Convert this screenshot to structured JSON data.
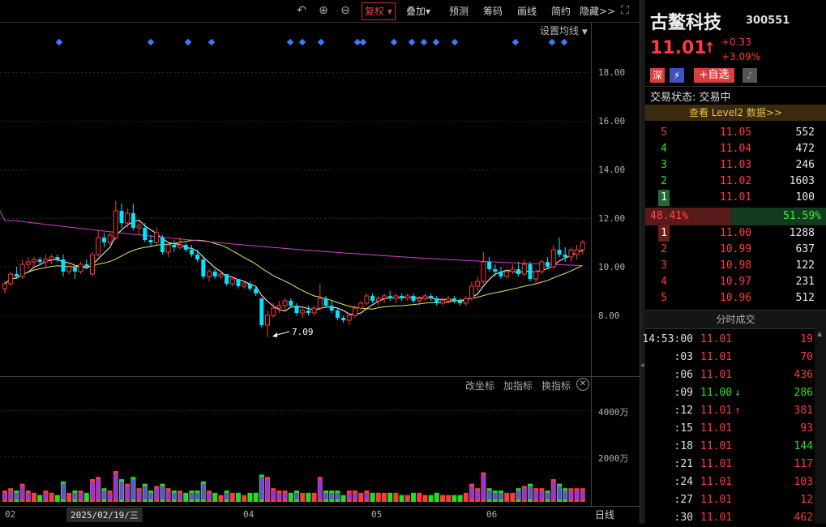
{
  "toolbar": {
    "fuquan": "复权",
    "diejia": "叠加",
    "yuce": "预测",
    "chouma": "筹码",
    "huaxian": "画线",
    "jianyue": "简约",
    "yincang": "隐藏>>",
    "undo_icon": "undo-icon",
    "zoom_in_icon": "zoom-in-icon",
    "zoom_out_icon": "zoom-out-icon",
    "expand_icon": "expand-icon"
  },
  "chart": {
    "set_ma_label": "设置均线",
    "price_ticks": [
      "18.00",
      "16.00",
      "14.00",
      "12.00",
      "10.00",
      "8.00"
    ],
    "low_annotation": "7.09",
    "indicator_buttons": [
      "改坐标",
      "加指标",
      "换指标"
    ],
    "volume_ticks": [
      "4000万",
      "2000万"
    ],
    "x_labels": [
      "02",
      "2025/02/19/三",
      "04",
      "05",
      "06"
    ],
    "period": "日线",
    "colors": {
      "up": "#ff3a3a",
      "down": "#00e5ff",
      "ma5": "#ffffff",
      "ma20": "#e8e85a",
      "ma60": "#d040d0",
      "signal": "#3a7cff"
    }
  },
  "chart_data": {
    "type": "candlestick",
    "ylim": [
      6.0,
      19.5
    ],
    "candles": [
      [
        9.1,
        9.4,
        8.9,
        9.3
      ],
      [
        9.3,
        9.8,
        9.2,
        9.7
      ],
      [
        9.7,
        10.0,
        9.5,
        9.6
      ],
      [
        9.6,
        10.3,
        9.5,
        10.1
      ],
      [
        10.1,
        10.4,
        9.9,
        10.2
      ],
      [
        10.2,
        10.4,
        10.0,
        10.3
      ],
      [
        10.3,
        10.4,
        10.1,
        10.2
      ],
      [
        10.2,
        10.5,
        10.0,
        10.3
      ],
      [
        10.3,
        10.5,
        10.1,
        10.4
      ],
      [
        10.4,
        10.5,
        10.2,
        10.3
      ],
      [
        10.3,
        10.5,
        9.6,
        9.8
      ],
      [
        9.8,
        10.1,
        9.7,
        10.0
      ],
      [
        10.0,
        10.0,
        9.5,
        9.8
      ],
      [
        9.8,
        10.2,
        9.7,
        10.1
      ],
      [
        10.1,
        10.3,
        9.9,
        10.0
      ],
      [
        9.7,
        10.6,
        9.6,
        10.5
      ],
      [
        10.5,
        11.5,
        10.4,
        11.2
      ],
      [
        11.2,
        11.4,
        10.8,
        11.0
      ],
      [
        11.0,
        11.4,
        10.9,
        11.3
      ],
      [
        11.2,
        12.7,
        11.1,
        12.3
      ],
      [
        12.3,
        12.6,
        11.6,
        11.8
      ],
      [
        11.8,
        12.4,
        11.6,
        12.2
      ],
      [
        12.2,
        12.6,
        11.5,
        11.6
      ],
      [
        11.6,
        11.9,
        11.3,
        11.7
      ],
      [
        11.6,
        11.8,
        11.0,
        11.1
      ],
      [
        11.1,
        11.3,
        10.8,
        11.0
      ],
      [
        11.0,
        11.6,
        10.9,
        11.4
      ],
      [
        11.2,
        11.3,
        10.5,
        10.6
      ],
      [
        10.6,
        11.0,
        10.4,
        10.9
      ],
      [
        10.9,
        11.1,
        10.6,
        10.8
      ],
      [
        10.8,
        11.2,
        10.7,
        10.9
      ],
      [
        10.9,
        11.0,
        10.6,
        10.7
      ],
      [
        10.7,
        10.9,
        10.4,
        10.5
      ],
      [
        10.5,
        10.7,
        10.2,
        10.3
      ],
      [
        10.3,
        10.4,
        9.5,
        9.6
      ],
      [
        9.6,
        9.9,
        9.4,
        9.8
      ],
      [
        9.8,
        9.9,
        9.5,
        9.6
      ],
      [
        9.6,
        9.8,
        9.5,
        9.7
      ],
      [
        9.7,
        9.7,
        9.2,
        9.3
      ],
      [
        9.3,
        9.6,
        9.2,
        9.5
      ],
      [
        9.5,
        9.5,
        9.1,
        9.2
      ],
      [
        9.2,
        9.4,
        9.1,
        9.3
      ],
      [
        9.3,
        9.4,
        9.0,
        9.1
      ],
      [
        9.1,
        9.2,
        8.8,
        8.9
      ],
      [
        8.7,
        8.7,
        7.5,
        7.6
      ],
      [
        7.6,
        8.2,
        7.1,
        8.0
      ],
      [
        8.0,
        8.5,
        7.9,
        8.3
      ],
      [
        8.3,
        8.6,
        8.1,
        8.4
      ],
      [
        8.4,
        8.7,
        8.2,
        8.6
      ],
      [
        8.6,
        8.7,
        8.3,
        8.4
      ],
      [
        8.4,
        8.5,
        8.0,
        8.1
      ],
      [
        8.1,
        8.3,
        7.9,
        8.2
      ],
      [
        8.2,
        8.4,
        8.0,
        8.1
      ],
      [
        8.1,
        8.4,
        8.0,
        8.3
      ],
      [
        8.3,
        9.3,
        8.2,
        8.7
      ],
      [
        8.7,
        8.8,
        8.3,
        8.4
      ],
      [
        8.4,
        8.6,
        8.1,
        8.2
      ],
      [
        8.2,
        8.3,
        7.8,
        7.9
      ],
      [
        7.9,
        8.0,
        7.7,
        7.8
      ],
      [
        7.8,
        8.1,
        7.6,
        8.0
      ],
      [
        8.0,
        8.4,
        7.9,
        8.3
      ],
      [
        8.3,
        8.6,
        8.2,
        8.5
      ],
      [
        8.5,
        8.9,
        8.4,
        8.8
      ],
      [
        8.8,
        8.9,
        8.5,
        8.6
      ],
      [
        8.6,
        8.8,
        8.4,
        8.7
      ],
      [
        8.7,
        8.9,
        8.5,
        8.8
      ],
      [
        8.8,
        9.0,
        8.6,
        8.7
      ],
      [
        8.7,
        8.9,
        8.5,
        8.8
      ],
      [
        8.8,
        8.9,
        8.6,
        8.7
      ],
      [
        8.7,
        8.9,
        8.6,
        8.8
      ],
      [
        8.8,
        8.9,
        8.5,
        8.6
      ],
      [
        8.6,
        8.8,
        8.4,
        8.7
      ],
      [
        8.7,
        8.9,
        8.6,
        8.8
      ],
      [
        8.8,
        8.9,
        8.6,
        8.7
      ],
      [
        8.7,
        8.8,
        8.4,
        8.5
      ],
      [
        8.5,
        8.7,
        8.4,
        8.6
      ],
      [
        8.6,
        8.8,
        8.5,
        8.7
      ],
      [
        8.7,
        8.8,
        8.5,
        8.6
      ],
      [
        8.6,
        8.7,
        8.4,
        8.5
      ],
      [
        8.5,
        8.8,
        8.4,
        8.7
      ],
      [
        8.7,
        9.4,
        8.6,
        9.2
      ],
      [
        9.2,
        9.6,
        9.0,
        9.4
      ],
      [
        9.4,
        10.6,
        9.3,
        10.2
      ],
      [
        10.2,
        10.4,
        9.8,
        9.9
      ],
      [
        9.9,
        10.1,
        9.6,
        9.8
      ],
      [
        9.8,
        10.0,
        9.5,
        9.6
      ],
      [
        9.6,
        9.9,
        9.5,
        9.8
      ],
      [
        9.8,
        10.1,
        9.7,
        9.9
      ],
      [
        9.9,
        10.2,
        9.6,
        9.7
      ],
      [
        9.7,
        10.3,
        9.6,
        10.1
      ],
      [
        10.1,
        10.2,
        9.4,
        9.5
      ],
      [
        9.5,
        9.9,
        9.3,
        9.8
      ],
      [
        9.8,
        10.3,
        9.7,
        10.2
      ],
      [
        10.2,
        10.4,
        9.9,
        10.0
      ],
      [
        10.0,
        10.9,
        9.9,
        10.7
      ],
      [
        10.7,
        11.2,
        10.4,
        10.5
      ],
      [
        10.5,
        10.8,
        10.2,
        10.4
      ],
      [
        10.4,
        10.8,
        10.2,
        10.7
      ],
      [
        10.5,
        10.9,
        10.3,
        10.7
      ],
      [
        10.7,
        11.1,
        10.5,
        11.0
      ]
    ],
    "volume_ylim": [
      0,
      5000
    ]
  },
  "stock": {
    "name": "古鳌科技",
    "code": "300551",
    "price": "11.01",
    "change": "+0.33",
    "change_pct": "+3.09%",
    "tag_market": "深",
    "tag_flash": "⚡",
    "add_watch": "+自选",
    "status": "交易状态: 交易中",
    "level2": "查看 Level2 数据>>"
  },
  "orderbook": {
    "asks": [
      {
        "lvl": "5",
        "price": "11.05",
        "vol": "552"
      },
      {
        "lvl": "4",
        "price": "11.04",
        "vol": "472"
      },
      {
        "lvl": "3",
        "price": "11.03",
        "vol": "246"
      },
      {
        "lvl": "2",
        "price": "11.02",
        "vol": "1603"
      },
      {
        "lvl": "1",
        "price": "11.01",
        "vol": "100"
      }
    ],
    "buy_pct": "48.41%",
    "sell_pct": "51.59%",
    "bids": [
      {
        "lvl": "1",
        "price": "11.00",
        "vol": "1288"
      },
      {
        "lvl": "2",
        "price": "10.99",
        "vol": "637"
      },
      {
        "lvl": "3",
        "price": "10.98",
        "vol": "122"
      },
      {
        "lvl": "4",
        "price": "10.97",
        "vol": "231"
      },
      {
        "lvl": "5",
        "price": "10.96",
        "vol": "512"
      }
    ]
  },
  "ticks": {
    "title": "分时成交",
    "rows": [
      {
        "time": "14:53:00",
        "price": "11.01",
        "dir": "",
        "vol": "19",
        "vc": "red"
      },
      {
        "time": ":03",
        "price": "11.01",
        "dir": "",
        "vol": "70",
        "vc": "red"
      },
      {
        "time": ":06",
        "price": "11.01",
        "dir": "",
        "vol": "436",
        "vc": "red"
      },
      {
        "time": ":09",
        "price": "11.00",
        "dir": "↓",
        "vol": "286",
        "vc": "green"
      },
      {
        "time": ":12",
        "price": "11.01",
        "dir": "↑",
        "vol": "381",
        "vc": "red"
      },
      {
        "time": ":15",
        "price": "11.01",
        "dir": "",
        "vol": "93",
        "vc": "red"
      },
      {
        "time": ":18",
        "price": "11.01",
        "dir": "",
        "vol": "144",
        "vc": "green"
      },
      {
        "time": ":21",
        "price": "11.01",
        "dir": "",
        "vol": "117",
        "vc": "red"
      },
      {
        "time": ":24",
        "price": "11.01",
        "dir": "",
        "vol": "103",
        "vc": "red"
      },
      {
        "time": ":27",
        "price": "11.01",
        "dir": "",
        "vol": "12",
        "vc": "red"
      },
      {
        "time": ":30",
        "price": "11.01",
        "dir": "",
        "vol": "462",
        "vc": "red"
      }
    ]
  }
}
